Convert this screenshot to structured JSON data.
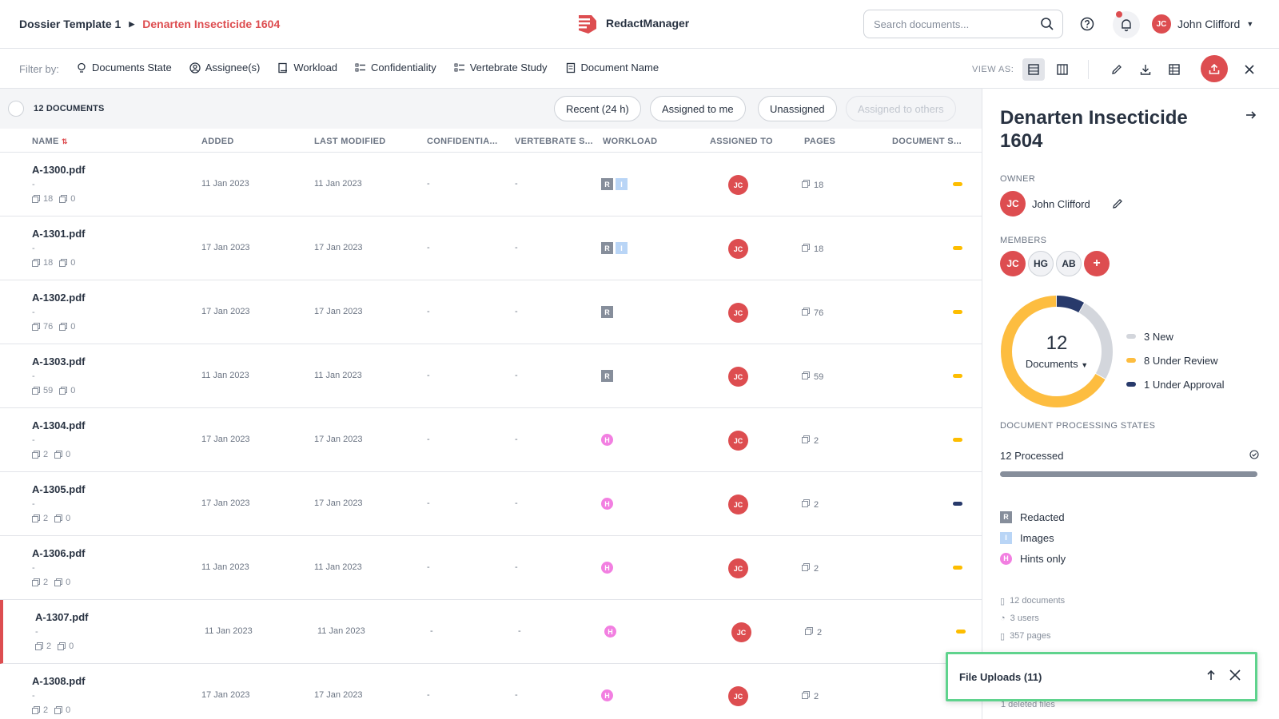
{
  "breadcrumb": {
    "parent": "Dossier Template 1",
    "current": "Denarten Insecticide 1604"
  },
  "app": {
    "name": "RedactManager"
  },
  "search": {
    "placeholder": "Search documents..."
  },
  "user": {
    "initials": "JC",
    "name": "John Clifford"
  },
  "filterbar": {
    "label": "Filter by:",
    "filters": [
      "Documents State",
      "Assignee(s)",
      "Workload",
      "Confidentiality",
      "Vertebrate Study",
      "Document Name"
    ],
    "view_as": "VIEW AS:"
  },
  "list": {
    "count_label": "12 DOCUMENTS",
    "quick_filters": [
      "Recent (24 h)",
      "Assigned to me",
      "Unassigned",
      "Assigned to others"
    ],
    "columns": [
      "NAME",
      "ADDED",
      "LAST MODIFIED",
      "CONFIDENTIA...",
      "VERTEBRATE S...",
      "WORKLOAD",
      "ASSIGNED TO",
      "PAGES",
      "DOCUMENT S..."
    ],
    "rows": [
      {
        "name": "A-1300.pdf",
        "sub": "-",
        "pages_meta": "18",
        "comments": "0",
        "added": "11 Jan 2023",
        "modified": "11 Jan 2023",
        "conf": "-",
        "vert": "-",
        "workload": [
          "R",
          "I"
        ],
        "assignee": "JC",
        "pages": "18",
        "state_color": "#fdbd00"
      },
      {
        "name": "A-1301.pdf",
        "sub": "-",
        "pages_meta": "18",
        "comments": "0",
        "added": "17 Jan 2023",
        "modified": "17 Jan 2023",
        "conf": "-",
        "vert": "-",
        "workload": [
          "R",
          "I"
        ],
        "assignee": "JC",
        "pages": "18",
        "state_color": "#fdbd00"
      },
      {
        "name": "A-1302.pdf",
        "sub": "-",
        "pages_meta": "76",
        "comments": "0",
        "added": "17 Jan 2023",
        "modified": "17 Jan 2023",
        "conf": "-",
        "vert": "-",
        "workload": [
          "R"
        ],
        "assignee": "JC",
        "pages": "76",
        "state_color": "#fdbd00"
      },
      {
        "name": "A-1303.pdf",
        "sub": "-",
        "pages_meta": "59",
        "comments": "0",
        "added": "11 Jan 2023",
        "modified": "11 Jan 2023",
        "conf": "-",
        "vert": "-",
        "workload": [
          "R"
        ],
        "assignee": "JC",
        "pages": "59",
        "state_color": "#fdbd00"
      },
      {
        "name": "A-1304.pdf",
        "sub": "-",
        "pages_meta": "2",
        "comments": "0",
        "added": "17 Jan 2023",
        "modified": "17 Jan 2023",
        "conf": "-",
        "vert": "-",
        "workload": [
          "H"
        ],
        "assignee": "JC",
        "pages": "2",
        "state_color": "#fdbd00"
      },
      {
        "name": "A-1305.pdf",
        "sub": "-",
        "pages_meta": "2",
        "comments": "0",
        "added": "17 Jan 2023",
        "modified": "17 Jan 2023",
        "conf": "-",
        "vert": "-",
        "workload": [
          "H"
        ],
        "assignee": "JC",
        "pages": "2",
        "state_color": "#283a6b"
      },
      {
        "name": "A-1306.pdf",
        "sub": "-",
        "pages_meta": "2",
        "comments": "0",
        "added": "11 Jan 2023",
        "modified": "11 Jan 2023",
        "conf": "-",
        "vert": "-",
        "workload": [
          "H"
        ],
        "assignee": "JC",
        "pages": "2",
        "state_color": "#fdbd00"
      },
      {
        "name": "A-1307.pdf",
        "sub": "-",
        "pages_meta": "2",
        "comments": "0",
        "added": "11 Jan 2023",
        "modified": "11 Jan 2023",
        "conf": "-",
        "vert": "-",
        "workload": [
          "H"
        ],
        "assignee": "JC",
        "pages": "2",
        "state_color": "#fdbd00"
      },
      {
        "name": "A-1308.pdf",
        "sub": "-",
        "pages_meta": "2",
        "comments": "0",
        "added": "17 Jan 2023",
        "modified": "17 Jan 2023",
        "conf": "-",
        "vert": "-",
        "workload": [
          "H"
        ],
        "assignee": "JC",
        "pages": "2",
        "state_color": null
      }
    ]
  },
  "panel": {
    "title": "Denarten Insecticide 1604",
    "owner_label": "OWNER",
    "owner": {
      "initials": "JC",
      "name": "John Clifford"
    },
    "members_label": "MEMBERS",
    "members": [
      "JC",
      "HG",
      "AB",
      "+"
    ],
    "donut": {
      "total": "12",
      "label": "Documents",
      "segments": [
        {
          "label": "3 New",
          "value": 3,
          "color": "#d3d6dc"
        },
        {
          "label": "8 Under Review",
          "value": 8,
          "color": "#fdbd40"
        },
        {
          "label": "1 Under Approval",
          "value": 1,
          "color": "#283a6b"
        }
      ]
    },
    "processing_label": "DOCUMENT PROCESSING STATES",
    "processed": "12 Processed",
    "processed_fraction": 1.0,
    "workload_legend": [
      {
        "key": "R",
        "label": "Redacted"
      },
      {
        "key": "I",
        "label": "Images"
      },
      {
        "key": "H",
        "label": "Hints only"
      }
    ],
    "stats": [
      "12 documents",
      "3 users",
      "357 pages"
    ],
    "deleted": "1 deleted files"
  },
  "uploads": {
    "title": "File Uploads (11)"
  },
  "colors": {
    "accent": "#dd4d50",
    "review": "#fdbd40",
    "approval": "#283a6b",
    "new": "#d3d6dc"
  }
}
